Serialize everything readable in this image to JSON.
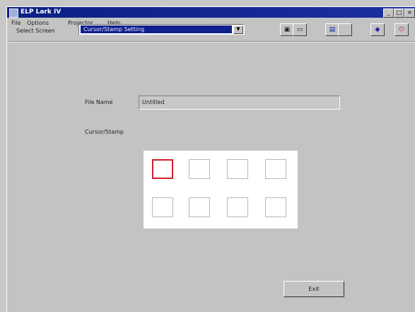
{
  "window": {
    "title": "ELP Lark IV"
  },
  "titlebar_buttons": {
    "minimize": "_",
    "maximize": "□",
    "close": "×"
  },
  "menu": [
    "File",
    "Options",
    "Projector",
    "Help"
  ],
  "toolbar": {
    "select_label": "Select Screen",
    "select_value": "Cursor/Stamp Setting",
    "tools": [
      "save-icon",
      "print-icon",
      "monitor-icon",
      "blank-icon",
      "pointer-icon",
      "power-icon"
    ]
  },
  "form": {
    "file_name_label": "File Name",
    "file_name_value": "Untitled",
    "cursor_display_label": "Cursor/Stamp"
  },
  "grid": {
    "rows": 2,
    "cols": 4,
    "selected_index": 0
  },
  "buttons": {
    "exit": "Exit"
  },
  "colors": {
    "titlebar": "#0a1f84",
    "selection": "#0f1f8c",
    "selected_cell_border": "#d11f2a"
  }
}
